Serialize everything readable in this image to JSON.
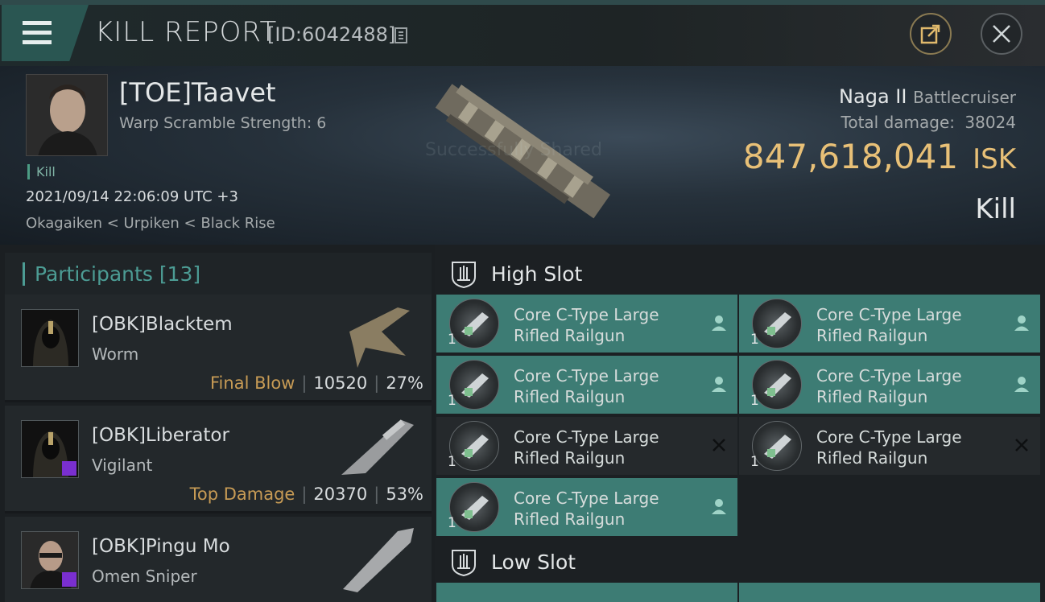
{
  "header": {
    "title": "KILL REPORT",
    "id_label": "[ID:6042488]"
  },
  "victim": {
    "name": "[TOE]Taavet",
    "subtitle": "Warp Scramble Strength: 6",
    "tag": "Kill",
    "datetime": "2021/09/14 22:06:09 UTC +3",
    "location": "Okagaiken < Urpiken < Black Rise",
    "ship_name": "Naga II",
    "ship_class": "Battlecruiser",
    "total_damage_label": "Total damage:",
    "total_damage": "38024",
    "isk_value": "847,618,041",
    "isk_unit": "ISK",
    "result": "Kill",
    "watermark": "Successfully Shared"
  },
  "participants": {
    "label": "Participants",
    "count": "[13]",
    "rows": [
      {
        "name": "[OBK]Blacktem",
        "ship": "Worm",
        "role": "Final Blow",
        "damage": "10520",
        "percent": "27%"
      },
      {
        "name": "[OBK]Liberator",
        "ship": "Vigilant",
        "role": "Top Damage",
        "damage": "20370",
        "percent": "53%"
      },
      {
        "name": "[OBK]Pingu Mo",
        "ship": "Omen Sniper",
        "role": "",
        "damage": "",
        "percent": ""
      }
    ]
  },
  "fitting": {
    "high_slot_title": "High Slot",
    "low_slot_title": "Low Slot",
    "high_slot_modules": [
      {
        "name_line1": "Core C-Type Large",
        "name_line2": "Rifled Railgun",
        "qty": "1",
        "status": "dropped"
      },
      {
        "name_line1": "Core C-Type Large",
        "name_line2": "Rifled Railgun",
        "qty": "1",
        "status": "dropped"
      },
      {
        "name_line1": "Core C-Type Large",
        "name_line2": "Rifled Railgun",
        "qty": "1",
        "status": "dropped"
      },
      {
        "name_line1": "Core C-Type Large",
        "name_line2": "Rifled Railgun",
        "qty": "1",
        "status": "dropped"
      },
      {
        "name_line1": "Core C-Type Large",
        "name_line2": "Rifled Railgun",
        "qty": "1",
        "status": "destroyed"
      },
      {
        "name_line1": "Core C-Type Large",
        "name_line2": "Rifled Railgun",
        "qty": "1",
        "status": "destroyed"
      },
      {
        "name_line1": "Core C-Type Large",
        "name_line2": "Rifled Railgun",
        "qty": "1",
        "status": "dropped"
      }
    ]
  },
  "colors": {
    "accent_teal": "#3d7c74",
    "isk_gold": "#e8c077",
    "role_gold": "#c79b55",
    "destroyed": "#25292c"
  },
  "icons": [
    "menu-icon",
    "copy-icon",
    "share-icon",
    "close-icon",
    "high-slot-icon",
    "low-slot-icon",
    "pilot-icon",
    "destroyed-x-icon"
  ]
}
